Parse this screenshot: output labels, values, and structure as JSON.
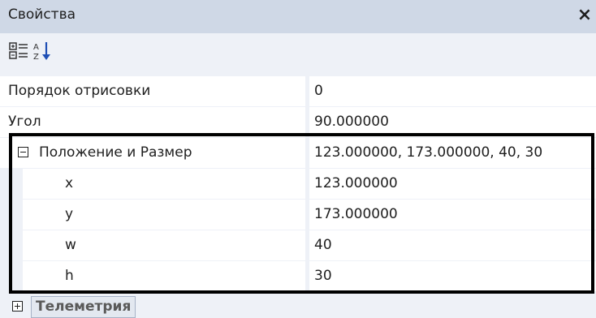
{
  "panel": {
    "title": "Свойства",
    "close_symbol": "×"
  },
  "toolbar": {
    "categorized_icon": "categorized-icon",
    "alphabetical_icon": "sort-alphabetical-icon"
  },
  "properties": [
    {
      "name": "Порядок отрисовки",
      "value": "0"
    },
    {
      "name": "Угол",
      "value": "90.000000"
    },
    {
      "name": "Положение и Размер",
      "value": "123.000000, 173.000000, 40, 30",
      "expanded": true
    },
    {
      "name": "x",
      "value": "123.000000"
    },
    {
      "name": "y",
      "value": "173.000000"
    },
    {
      "name": "w",
      "value": "40"
    },
    {
      "name": "h",
      "value": "30"
    }
  ],
  "category": {
    "label": "Телеметрия",
    "expanded": false
  },
  "colors": {
    "title_bar": "#cfd8e6",
    "grid_line": "#eef1f7",
    "highlight_border": "#000000"
  }
}
